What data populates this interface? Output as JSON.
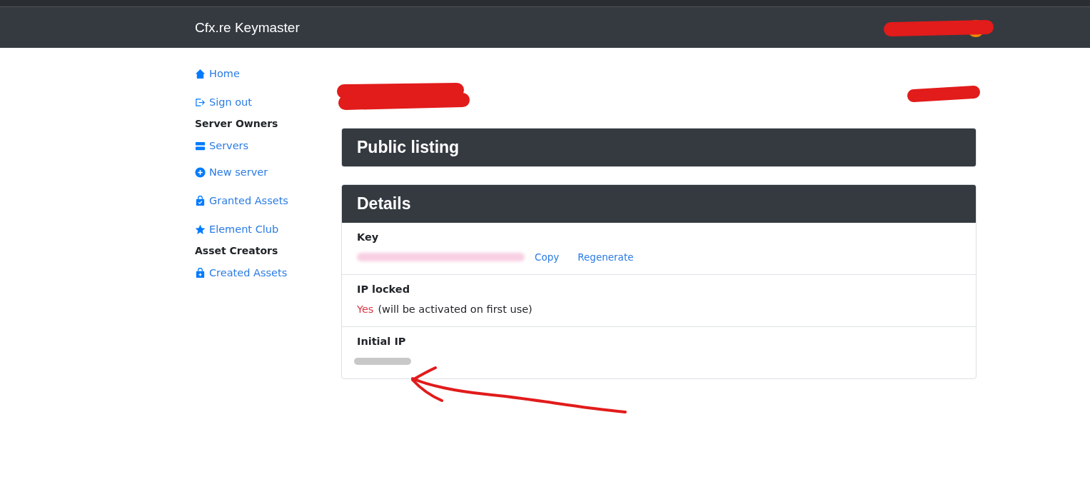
{
  "navbar": {
    "brand": "Cfx.re Keymaster"
  },
  "sidebar": {
    "items": [
      {
        "kind": "link",
        "label": "Home"
      },
      {
        "kind": "link",
        "label": "Sign out"
      },
      {
        "kind": "heading",
        "label": "Server Owners"
      },
      {
        "kind": "link",
        "label": "Servers"
      },
      {
        "kind": "link",
        "label": "New server"
      },
      {
        "kind": "link",
        "label": "Granted Assets"
      },
      {
        "kind": "link",
        "label": "Element Club"
      },
      {
        "kind": "heading",
        "label": "Asset Creators"
      },
      {
        "kind": "link",
        "label": "Created Assets"
      }
    ]
  },
  "cards": [
    {
      "title": "Public listing"
    },
    {
      "title": "Details",
      "rows": [
        {
          "kind": "key",
          "label": "Key",
          "actions": [
            "Copy",
            "Regenerate"
          ]
        },
        {
          "kind": "status",
          "label": "IP locked",
          "locked": true,
          "value": "Yes",
          "note": "(will be activated on first use)"
        },
        {
          "kind": "hidden",
          "label": "Initial IP"
        }
      ]
    }
  ]
}
